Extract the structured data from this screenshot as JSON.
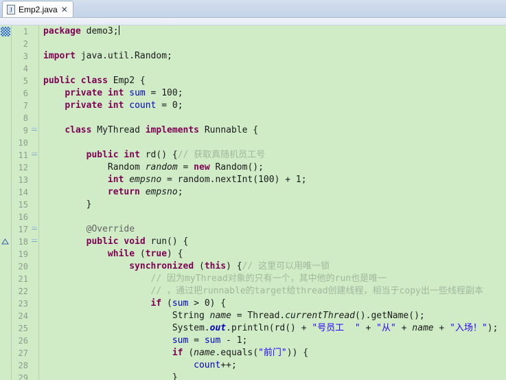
{
  "window": {
    "title": "Emp2.java"
  },
  "tab": {
    "label": "Emp2.java",
    "close_glyph": "✕",
    "icon": "java-file-icon"
  },
  "editor": {
    "background_color": "#cfecc6",
    "gutter_color": "#cfecc6",
    "line_number_color": "#8f9a8b",
    "keyword_color": "#7f0055",
    "string_color": "#2a00ff",
    "comment_color": "#9fb89c",
    "field_color": "#0000c0",
    "first_line_number": 1,
    "last_line_number": 29,
    "caret_line": 1,
    "annotations": [
      {
        "line": 1,
        "type": "occurrence-marker"
      },
      {
        "line": 18,
        "type": "override-marker"
      }
    ],
    "fold_markers": [
      9,
      11,
      17,
      18
    ],
    "lines": [
      {
        "n": 1,
        "tokens": [
          {
            "t": "package",
            "c": "kw"
          },
          {
            "t": " demo3;",
            "c": "plain"
          }
        ],
        "caret": true
      },
      {
        "n": 2,
        "tokens": []
      },
      {
        "n": 3,
        "tokens": [
          {
            "t": "import",
            "c": "kw"
          },
          {
            "t": " java.util.Random;",
            "c": "plain"
          }
        ]
      },
      {
        "n": 4,
        "tokens": []
      },
      {
        "n": 5,
        "tokens": [
          {
            "t": "public",
            "c": "kw"
          },
          {
            "t": " ",
            "c": "plain"
          },
          {
            "t": "class",
            "c": "kw"
          },
          {
            "t": " Emp2 {",
            "c": "plain"
          }
        ]
      },
      {
        "n": 6,
        "tokens": [
          {
            "t": "    ",
            "c": "plain"
          },
          {
            "t": "private",
            "c": "kw"
          },
          {
            "t": " ",
            "c": "plain"
          },
          {
            "t": "int",
            "c": "kw"
          },
          {
            "t": " ",
            "c": "plain"
          },
          {
            "t": "sum",
            "c": "fld"
          },
          {
            "t": " = 100;",
            "c": "plain"
          }
        ]
      },
      {
        "n": 7,
        "tokens": [
          {
            "t": "    ",
            "c": "plain"
          },
          {
            "t": "private",
            "c": "kw"
          },
          {
            "t": " ",
            "c": "plain"
          },
          {
            "t": "int",
            "c": "kw"
          },
          {
            "t": " ",
            "c": "plain"
          },
          {
            "t": "count",
            "c": "fld"
          },
          {
            "t": " = 0;",
            "c": "plain"
          }
        ]
      },
      {
        "n": 8,
        "tokens": []
      },
      {
        "n": 9,
        "tokens": [
          {
            "t": "    ",
            "c": "plain"
          },
          {
            "t": "class",
            "c": "kw"
          },
          {
            "t": " MyThread ",
            "c": "plain"
          },
          {
            "t": "implements",
            "c": "kw"
          },
          {
            "t": " Runnable {",
            "c": "plain"
          }
        ]
      },
      {
        "n": 10,
        "tokens": []
      },
      {
        "n": 11,
        "tokens": [
          {
            "t": "        ",
            "c": "plain"
          },
          {
            "t": "public",
            "c": "kw"
          },
          {
            "t": " ",
            "c": "plain"
          },
          {
            "t": "int",
            "c": "kw"
          },
          {
            "t": " rd() {",
            "c": "plain"
          },
          {
            "t": "// 获取真随机员工号",
            "c": "cmt"
          }
        ]
      },
      {
        "n": 12,
        "tokens": [
          {
            "t": "            Random ",
            "c": "plain"
          },
          {
            "t": "random",
            "c": "mstat"
          },
          {
            "t": " = ",
            "c": "plain"
          },
          {
            "t": "new",
            "c": "kw"
          },
          {
            "t": " Random();",
            "c": "plain"
          }
        ]
      },
      {
        "n": 13,
        "tokens": [
          {
            "t": "            ",
            "c": "plain"
          },
          {
            "t": "int",
            "c": "kw"
          },
          {
            "t": " ",
            "c": "plain"
          },
          {
            "t": "empsno",
            "c": "mstat"
          },
          {
            "t": " = random.nextInt(100) + 1;",
            "c": "plain"
          }
        ]
      },
      {
        "n": 14,
        "tokens": [
          {
            "t": "            ",
            "c": "plain"
          },
          {
            "t": "return",
            "c": "kw"
          },
          {
            "t": " ",
            "c": "plain"
          },
          {
            "t": "empsno",
            "c": "mstat"
          },
          {
            "t": ";",
            "c": "plain"
          }
        ]
      },
      {
        "n": 15,
        "tokens": [
          {
            "t": "        }",
            "c": "plain"
          }
        ]
      },
      {
        "n": 16,
        "tokens": []
      },
      {
        "n": 17,
        "tokens": [
          {
            "t": "        ",
            "c": "plain"
          },
          {
            "t": "@Override",
            "c": "ann"
          }
        ]
      },
      {
        "n": 18,
        "tokens": [
          {
            "t": "        ",
            "c": "plain"
          },
          {
            "t": "public",
            "c": "kw"
          },
          {
            "t": " ",
            "c": "plain"
          },
          {
            "t": "void",
            "c": "kw"
          },
          {
            "t": " run() {",
            "c": "plain"
          }
        ]
      },
      {
        "n": 19,
        "tokens": [
          {
            "t": "            ",
            "c": "plain"
          },
          {
            "t": "while",
            "c": "kw"
          },
          {
            "t": " (",
            "c": "plain"
          },
          {
            "t": "true",
            "c": "kw"
          },
          {
            "t": ") {",
            "c": "plain"
          }
        ]
      },
      {
        "n": 20,
        "tokens": [
          {
            "t": "                ",
            "c": "plain"
          },
          {
            "t": "synchronized",
            "c": "kw"
          },
          {
            "t": " (",
            "c": "plain"
          },
          {
            "t": "this",
            "c": "kw"
          },
          {
            "t": ") {",
            "c": "plain"
          },
          {
            "t": "// 这里可以用唯一锁",
            "c": "cmt"
          }
        ]
      },
      {
        "n": 21,
        "tokens": [
          {
            "t": "                    ",
            "c": "plain"
          },
          {
            "t": "// 因为myThread对象的只有一个，其中他的run也是唯一",
            "c": "cmt"
          }
        ]
      },
      {
        "n": 22,
        "tokens": [
          {
            "t": "                    ",
            "c": "plain"
          },
          {
            "t": "// ，通过把runnable的target给thread创建线程，相当于copy出一些线程副本",
            "c": "cmt"
          }
        ]
      },
      {
        "n": 23,
        "tokens": [
          {
            "t": "                    ",
            "c": "plain"
          },
          {
            "t": "if",
            "c": "kw"
          },
          {
            "t": " (",
            "c": "plain"
          },
          {
            "t": "sum",
            "c": "fld"
          },
          {
            "t": " > 0) {",
            "c": "plain"
          }
        ]
      },
      {
        "n": 24,
        "tokens": [
          {
            "t": "                        String ",
            "c": "plain"
          },
          {
            "t": "name",
            "c": "mstat"
          },
          {
            "t": " = Thread.",
            "c": "plain"
          },
          {
            "t": "currentThread",
            "c": "mstat"
          },
          {
            "t": "().getName();",
            "c": "plain"
          }
        ]
      },
      {
        "n": 25,
        "tokens": [
          {
            "t": "                        System.",
            "c": "plain"
          },
          {
            "t": "out",
            "c": "stat"
          },
          {
            "t": ".println(rd() + ",
            "c": "plain"
          },
          {
            "t": "\"号员工  \"",
            "c": "str"
          },
          {
            "t": " + ",
            "c": "plain"
          },
          {
            "t": "\"从\"",
            "c": "str"
          },
          {
            "t": " + ",
            "c": "plain"
          },
          {
            "t": "name",
            "c": "mstat"
          },
          {
            "t": " + ",
            "c": "plain"
          },
          {
            "t": "\"入场！\"",
            "c": "str"
          },
          {
            "t": ");",
            "c": "plain"
          }
        ]
      },
      {
        "n": 26,
        "tokens": [
          {
            "t": "                        ",
            "c": "plain"
          },
          {
            "t": "sum",
            "c": "fld"
          },
          {
            "t": " = ",
            "c": "plain"
          },
          {
            "t": "sum",
            "c": "fld"
          },
          {
            "t": " - 1;",
            "c": "plain"
          }
        ]
      },
      {
        "n": 27,
        "tokens": [
          {
            "t": "                        ",
            "c": "plain"
          },
          {
            "t": "if",
            "c": "kw"
          },
          {
            "t": " (",
            "c": "plain"
          },
          {
            "t": "name",
            "c": "mstat"
          },
          {
            "t": ".equals(",
            "c": "plain"
          },
          {
            "t": "\"前门\"",
            "c": "str"
          },
          {
            "t": ")) {",
            "c": "plain"
          }
        ]
      },
      {
        "n": 28,
        "tokens": [
          {
            "t": "                            ",
            "c": "plain"
          },
          {
            "t": "count",
            "c": "fld"
          },
          {
            "t": "++;",
            "c": "plain"
          }
        ]
      },
      {
        "n": 29,
        "tokens": [
          {
            "t": "                        }",
            "c": "plain"
          }
        ]
      }
    ]
  }
}
